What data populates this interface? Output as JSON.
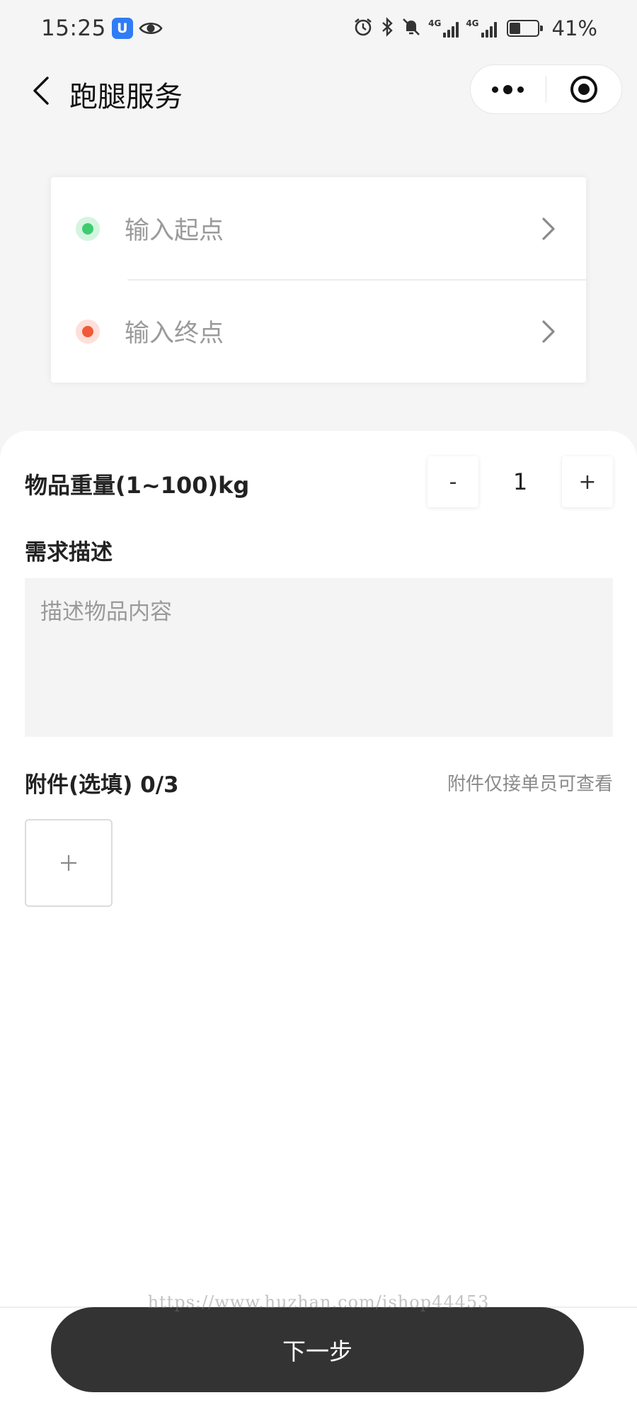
{
  "status_bar": {
    "time": "15:25",
    "app_badge": "U",
    "network_1": "4G",
    "network_2": "4G",
    "battery_level": 0.41,
    "battery_text": "41%",
    "icons": [
      "alarm-icon",
      "bluetooth-icon",
      "mute-icon",
      "signal-icon",
      "battery-icon",
      "eye-icon"
    ]
  },
  "nav": {
    "title": "跑腿服务",
    "back_icon": "chevron-left-icon",
    "more_icon": "more-dots-icon",
    "close_icon": "target-close-icon"
  },
  "address": {
    "start_placeholder": "输入起点",
    "end_placeholder": "输入终点",
    "start_color": "#3ecc70",
    "start_halo": "#d4f5df",
    "end_color": "#f05a3a",
    "end_halo": "#fde0d9"
  },
  "form": {
    "weight_label": "物品重量(1~100)kg",
    "weight_value": "1",
    "minus_label": "-",
    "plus_label": "+",
    "desc_label": "需求描述",
    "desc_placeholder": "描述物品内容",
    "attach_label": "附件(选填) 0/3",
    "attach_note": "附件仅接单员可查看",
    "upload_icon": "plus-icon"
  },
  "watermark": "https://www.huzhan.com/ishop44453",
  "footer": {
    "next_label": "下一步",
    "button_color": "#333333"
  }
}
